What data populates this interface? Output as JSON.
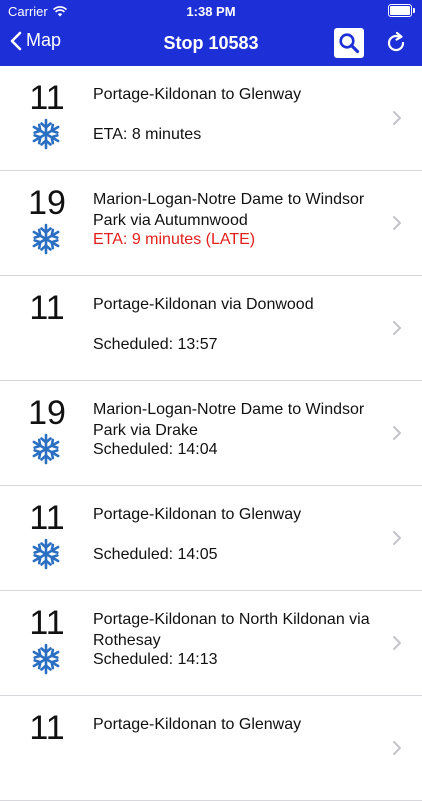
{
  "status_bar": {
    "carrier": "Carrier",
    "time": "1:38 PM"
  },
  "nav": {
    "back_label": "Map",
    "title": "Stop 10583"
  },
  "arrivals": [
    {
      "route": "11",
      "destination": "Portage-Kildonan to Glenway",
      "eta": "ETA: 8 minutes",
      "late": false,
      "snow": true
    },
    {
      "route": "19",
      "destination": "Marion-Logan-Notre Dame to Windsor Park via Autumnwood",
      "eta": "ETA: 9 minutes (LATE)",
      "late": true,
      "snow": true
    },
    {
      "route": "11",
      "destination": "Portage-Kildonan via Donwood",
      "eta": "Scheduled: 13:57",
      "late": false,
      "snow": false
    },
    {
      "route": "19",
      "destination": "Marion-Logan-Notre Dame to Windsor Park via Drake",
      "eta": "Scheduled: 14:04",
      "late": false,
      "snow": true
    },
    {
      "route": "11",
      "destination": "Portage-Kildonan to Glenway",
      "eta": "Scheduled: 14:05",
      "late": false,
      "snow": true
    },
    {
      "route": "11",
      "destination": "Portage-Kildonan to North Kildonan via Rothesay",
      "eta": "Scheduled: 14:13",
      "late": false,
      "snow": true
    },
    {
      "route": "11",
      "destination": "Portage-Kildonan to Glenway",
      "eta": "",
      "late": false,
      "snow": false
    }
  ],
  "colors": {
    "header": "#1d2fd6",
    "late": "#e2201c",
    "snowflake": "#2b6fc2"
  }
}
